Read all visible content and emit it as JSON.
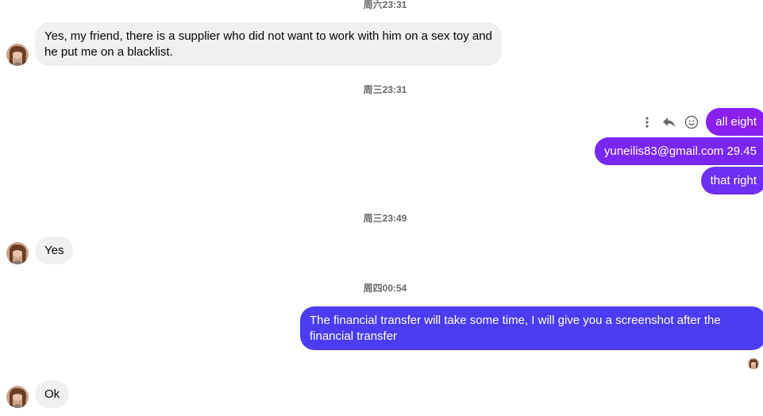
{
  "timestamps": {
    "t0": "周六23:31",
    "t1": "周三23:31",
    "t2": "周三23:49",
    "t3": "周四00:54"
  },
  "messages": {
    "m1": "Yes, my friend, there is a supplier who did not want to work with him on a sex toy and he put me on a blacklist.",
    "m2": "all eight",
    "m3": "yuneilis83@gmail.com 29.45",
    "m4": "that right",
    "m5": "Yes",
    "m6": "The financial transfer will take some time, I will give you a screenshot after the financial transfer",
    "m7": "Ok"
  },
  "message_actions": {
    "more": "more-options-icon",
    "reply": "reply-icon",
    "react": "emoji-react-icon"
  },
  "colors": {
    "incoming_bg": "#f0f0f0",
    "outgoing_purple": "#8a1ff0",
    "outgoing_blue": "#4a3cf0"
  }
}
